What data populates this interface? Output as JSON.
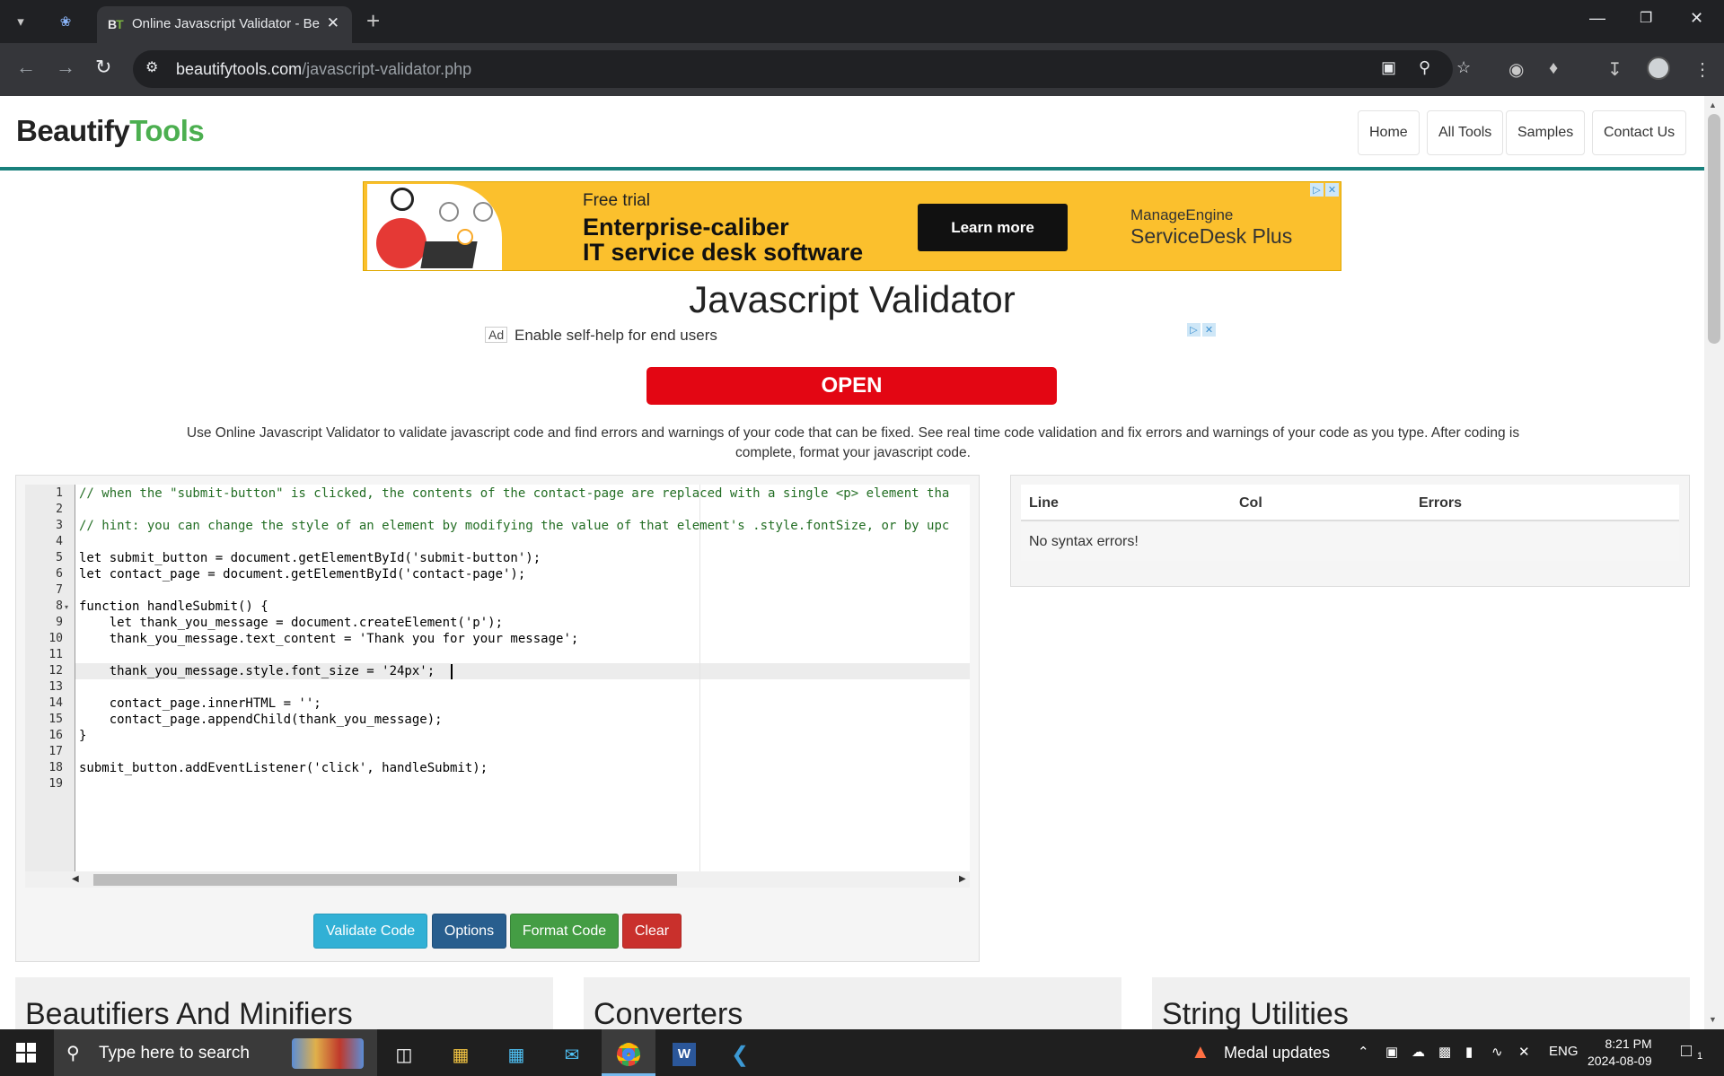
{
  "browser": {
    "tab_title": "Online Javascript Validator - Be",
    "tab_favicon_text": "BT",
    "url_domain": "beautifytools.com",
    "url_path": "/javascript-validator.php"
  },
  "site": {
    "logo_part1": "Beautify",
    "logo_part2": "Tools",
    "nav": [
      "Home",
      "All Tools",
      "Samples",
      "Contact Us"
    ]
  },
  "ad_banner": {
    "free_trial": "Free trial",
    "headline1": "Enterprise-caliber",
    "headline2": "IT service desk software",
    "button": "Learn more",
    "brand1": "ManageEngine",
    "brand2": "ServiceDesk Plus"
  },
  "page": {
    "title": "Javascript Validator",
    "ad2_tag": "Ad",
    "ad2_text": "Enable self-help for end users",
    "ad2_button": "OPEN",
    "description": "Use Online Javascript Validator to validate javascript code and find errors and warnings of your code that can be fixed. See real time code validation and fix errors and warnings of your code as you type. After coding is complete, format your javascript code."
  },
  "editor": {
    "line_numbers": [
      "1",
      "2",
      "3",
      "4",
      "5",
      "6",
      "7",
      "8",
      "9",
      "10",
      "11",
      "12",
      "13",
      "14",
      "15",
      "16",
      "17",
      "18",
      "19"
    ],
    "lines": [
      "// when the \"submit-button\" is clicked, the contents of the contact-page are replaced with a single <p> element tha",
      "",
      "// hint: you can change the style of an element by modifying the value of that element's .style.fontSize, or by upc",
      "",
      "let submit_button = document.getElementById('submit-button');",
      "let contact_page = document.getElementById('contact-page');",
      "",
      "function handleSubmit() {",
      "    let thank_you_message = document.createElement('p');",
      "    thank_you_message.text_content = 'Thank you for your message';",
      "",
      "    thank_you_message.style.font_size = '24px';",
      "",
      "    contact_page.innerHTML = '';",
      "    contact_page.appendChild(thank_you_message);",
      "}",
      "",
      "submit_button.addEventListener('click', handleSubmit);",
      ""
    ],
    "active_line": 12
  },
  "buttons": {
    "validate": "Validate Code",
    "options": "Options",
    "format": "Format Code",
    "clear": "Clear"
  },
  "results": {
    "columns": [
      "Line",
      "Col",
      "Errors"
    ],
    "message": "No syntax errors!"
  },
  "categories": [
    "Beautifiers And Minifiers",
    "Converters",
    "String Utilities"
  ],
  "taskbar": {
    "search_placeholder": "Type here to search",
    "notification": "Medal updates",
    "language": "ENG",
    "time": "8:21 PM",
    "date": "2024-08-09",
    "notification_count": "1"
  },
  "colors": {
    "accent": "#18807c",
    "logo_green": "#4caf50",
    "validate_btn": "#31b0d5",
    "options_btn": "#285e8e",
    "format_btn": "#449d44",
    "clear_btn": "#c9302c",
    "open_btn": "#e30613",
    "ad_bg": "#fbc02d"
  }
}
